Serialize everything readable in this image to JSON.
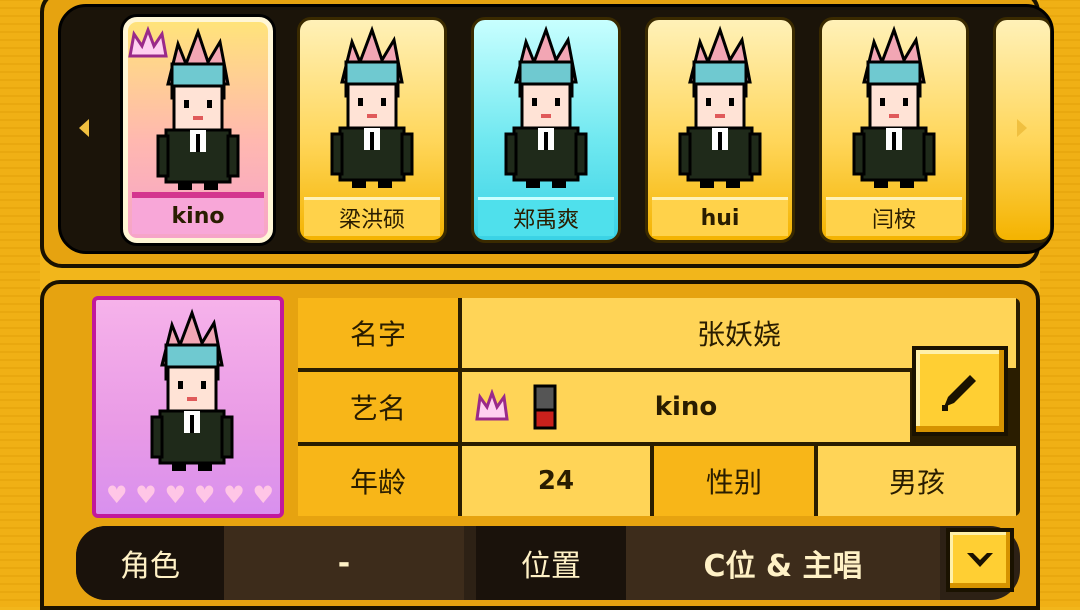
{
  "roster": {
    "cards": [
      {
        "name": "kino",
        "state": "selected",
        "crown": true
      },
      {
        "name": "梁洪硕",
        "state": "normal",
        "crown": false
      },
      {
        "name": "郑禹爽",
        "state": "active",
        "crown": false
      },
      {
        "name": "hui",
        "state": "normal",
        "crown": false
      },
      {
        "name": "闫桉",
        "state": "normal",
        "crown": false
      }
    ]
  },
  "profile": {
    "name_label": "名字",
    "name_value": "张妖娆",
    "stage_name_label": "艺名",
    "stage_name_value": "kino",
    "age_label": "年龄",
    "age_value": "24",
    "gender_label": "性别",
    "gender_value": "男孩",
    "hearts_filled": 0,
    "hearts_total": 6
  },
  "roles": {
    "role_label": "角色",
    "role_value": "-",
    "position_label": "位置",
    "position_value": "C位 & 主唱"
  },
  "colors": {
    "panel": "#e6a310",
    "accent_pink": "#c2189c",
    "accent_cyan": "#4fe0ec"
  },
  "icons": [
    "left-arrow-icon",
    "right-arrow-icon",
    "crown-icon",
    "microphone-icon",
    "pencil-icon",
    "chevron-down-icon",
    "heart-icon"
  ]
}
